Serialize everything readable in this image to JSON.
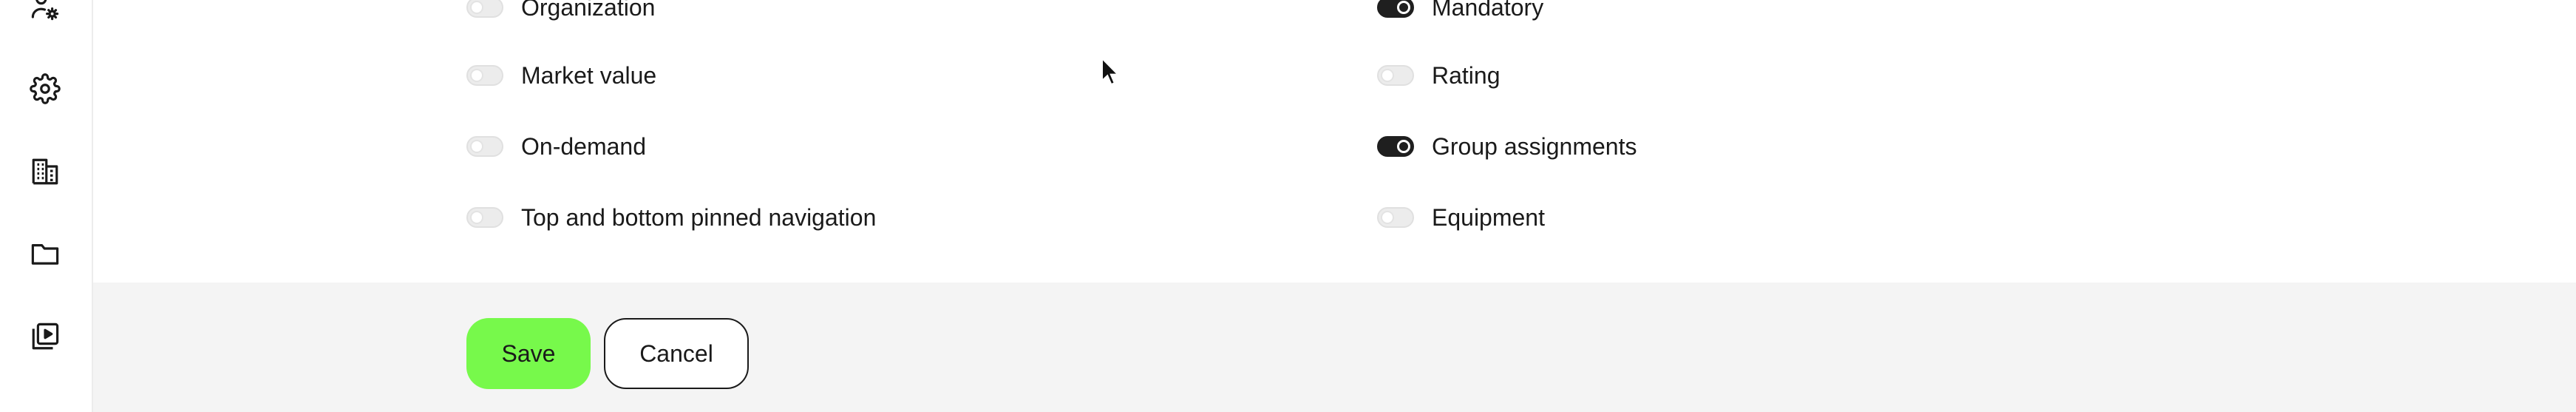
{
  "sidebar": {
    "icons": [
      {
        "name": "user-settings-icon"
      },
      {
        "name": "gear-icon"
      },
      {
        "name": "building-icon"
      },
      {
        "name": "folder-icon"
      },
      {
        "name": "video-library-icon"
      }
    ]
  },
  "settings": {
    "left_column": [
      {
        "label": "Organization",
        "enabled": false
      },
      {
        "label": "Market value",
        "enabled": false
      },
      {
        "label": "On-demand",
        "enabled": false
      },
      {
        "label": "Top and bottom pinned navigation",
        "enabled": false
      }
    ],
    "right_column": [
      {
        "label": "Mandatory",
        "enabled": true
      },
      {
        "label": "Rating",
        "enabled": false
      },
      {
        "label": "Group assignments",
        "enabled": true
      },
      {
        "label": "Equipment",
        "enabled": false
      }
    ]
  },
  "footer": {
    "save_label": "Save",
    "cancel_label": "Cancel"
  },
  "colors": {
    "accent_save": "#77f94b",
    "toggle_on": "#1f1f1f",
    "toggle_off": "#ececec",
    "footer_bg": "#f4f4f4"
  }
}
